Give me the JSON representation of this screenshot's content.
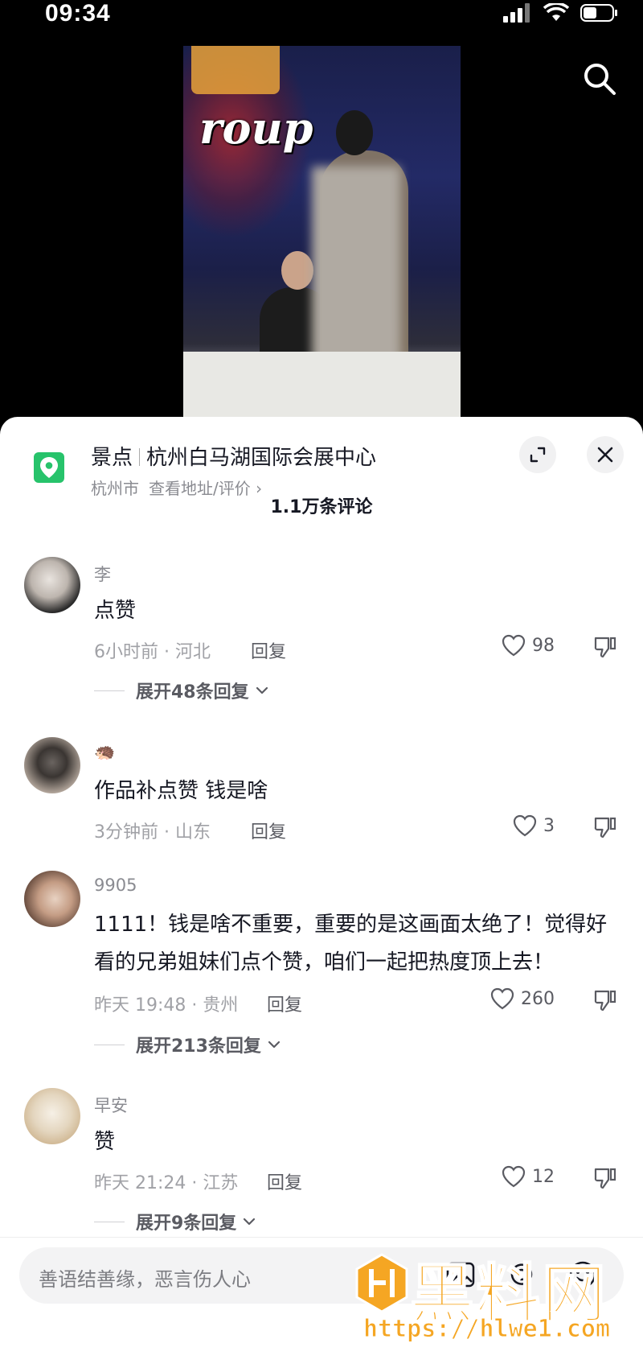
{
  "status_bar": {
    "time": "09:34"
  },
  "video": {
    "overlay_text": "roup"
  },
  "poi": {
    "category": "景点",
    "name": "杭州白马湖国际会展中心",
    "city": "杭州市",
    "link": "查看地址/评价 ›"
  },
  "comments_header": {
    "count_label": "1.1万条评论"
  },
  "comments": [
    {
      "name": "李",
      "text": "点赞",
      "meta": "6小时前 · 河北",
      "reply": "回复",
      "likes": "98",
      "expand": "展开48条回复"
    },
    {
      "name": "🦔",
      "text": "作品补点赞 钱是啥",
      "meta": "3分钟前 · 山东",
      "reply": "回复",
      "likes": "3"
    },
    {
      "name": "9905",
      "text": "1111！钱是啥不重要，重要的是这画面太绝了！觉得好看的兄弟姐妹们点个赞，咱们一起把热度顶上去！",
      "meta": "昨天 19:48 · 贵州",
      "reply": "回复",
      "likes": "260",
      "expand": "展开213条回复"
    },
    {
      "name": "早安",
      "text": "赞",
      "meta": "昨天 21:24 · 江苏",
      "reply": "回复",
      "likes": "12",
      "expand": "展开9条回复"
    }
  ],
  "input": {
    "placeholder": "善语结善缘，恶言伤人心"
  },
  "watermark": {
    "brand": "黑料网",
    "url": "https://hlwe1.com"
  },
  "colors": {
    "accent_green": "#27c36b",
    "watermark_orange": "#f5a623"
  },
  "icons": [
    "signal-icon",
    "wifi-icon",
    "battery-icon",
    "search-icon",
    "location-pin-icon",
    "expand-icon",
    "close-icon",
    "heart-icon",
    "dislike-icon",
    "chevron-down-icon",
    "at-icon",
    "emoji-icon",
    "image-icon"
  ]
}
